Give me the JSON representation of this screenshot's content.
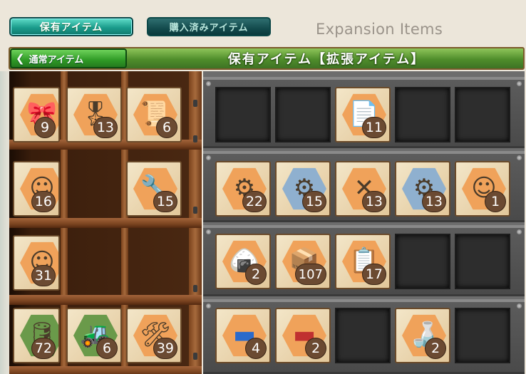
{
  "tabs": {
    "owned": "保有アイテム",
    "purchased": "購入済みアイテム"
  },
  "expansion_heading": "Expansion Items",
  "banner": {
    "back_label": "通常アイテム",
    "title": "保有アイテム【拡張アイテム】"
  },
  "colors": {
    "accent_teal": "#1b9c8c",
    "banner_green": "#4f8d2b",
    "count_badge": "#6b4a32"
  },
  "left_shelf": {
    "items": [
      {
        "icon": "ribbon-helmet-icon",
        "count": "9"
      },
      {
        "icon": "medal-icon",
        "count": "13"
      },
      {
        "icon": "blueprint-fairy-icon",
        "count": "6"
      },
      {
        "icon": "fairy-bun-icon",
        "count": "16"
      },
      {
        "icon": "wrench-girl-icon",
        "count": "15"
      },
      {
        "icon": "fairy-hat-icon",
        "count": "31"
      },
      {
        "icon": "fuel-drum-icon",
        "count": "72"
      },
      {
        "icon": "bulldozer-icon",
        "count": "6"
      },
      {
        "icon": "tools-set-icon",
        "count": "39"
      }
    ]
  },
  "right_grid": {
    "items": [
      {
        "icon": "documents-icon",
        "count": "11"
      },
      {
        "icon": "turret-icon",
        "count": "22"
      },
      {
        "icon": "gun-mount-icon",
        "count": "15"
      },
      {
        "icon": "machine-gun-icon",
        "count": "13"
      },
      {
        "icon": "cannon-fairy-icon",
        "count": "13"
      },
      {
        "icon": "girl-portrait-icon",
        "count": "1"
      },
      {
        "icon": "rice-ball-icon",
        "count": "2"
      },
      {
        "icon": "crates-icon",
        "count": "107"
      },
      {
        "icon": "report-papers-icon",
        "count": "17"
      },
      {
        "icon": "blue-cloth-icon",
        "count": "4"
      },
      {
        "icon": "red-cloth-icon",
        "count": "2"
      },
      {
        "icon": "sake-set-icon",
        "count": "2"
      }
    ]
  }
}
